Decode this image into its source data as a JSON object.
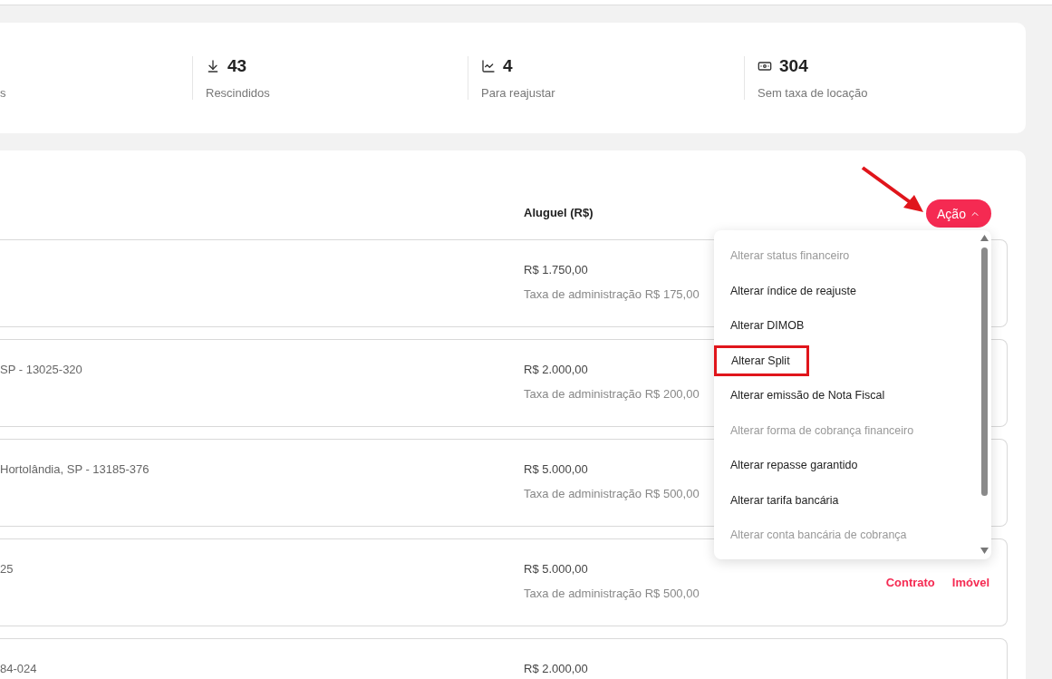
{
  "stats": [
    {
      "kind": "plain",
      "label": "s"
    },
    {
      "kind": "download",
      "value": "43",
      "label": "Rescindidos"
    },
    {
      "kind": "chart",
      "value": "4",
      "label": "Para reajustar"
    },
    {
      "kind": "money",
      "value": "304",
      "label": "Sem taxa de locação"
    }
  ],
  "table": {
    "columns": [
      "Aluguel (R$)"
    ],
    "action_button": {
      "label": "Ação",
      "expanded": true
    },
    "rows": [
      {
        "address": "",
        "rent": "R$ 1.750,00",
        "fee": "Taxa de administração R$ 175,00",
        "links": []
      },
      {
        "address": "SP - 13025-320",
        "rent": "R$ 2.000,00",
        "fee": "Taxa de administração R$ 200,00",
        "links": []
      },
      {
        "address": "Hortolândia, SP - 13185-376",
        "rent": "R$ 5.000,00",
        "fee": "Taxa de administração R$ 500,00",
        "links": []
      },
      {
        "address": "25",
        "rent": "R$ 5.000,00",
        "fee": "Taxa de administração R$ 500,00",
        "links": [
          "Contrato",
          "Imóvel"
        ]
      },
      {
        "address": "84-024",
        "rent": "R$ 2.000,00",
        "fee": "",
        "links": []
      }
    ]
  },
  "action_menu": {
    "items": [
      {
        "label": "Alterar status financeiro",
        "disabled": true,
        "highlighted": false
      },
      {
        "label": "Alterar índice de reajuste",
        "disabled": false,
        "highlighted": false
      },
      {
        "label": "Alterar DIMOB",
        "disabled": false,
        "highlighted": false
      },
      {
        "label": "Alterar Split",
        "disabled": false,
        "highlighted": true
      },
      {
        "label": "Alterar emissão de Nota Fiscal",
        "disabled": false,
        "highlighted": false
      },
      {
        "label": "Alterar forma de cobrança financeiro",
        "disabled": true,
        "highlighted": false
      },
      {
        "label": "Alterar repasse garantido",
        "disabled": false,
        "highlighted": false
      },
      {
        "label": "Alterar tarifa bancária",
        "disabled": false,
        "highlighted": false
      },
      {
        "label": "Alterar conta bancária de cobrança",
        "disabled": true,
        "highlighted": false
      }
    ]
  }
}
